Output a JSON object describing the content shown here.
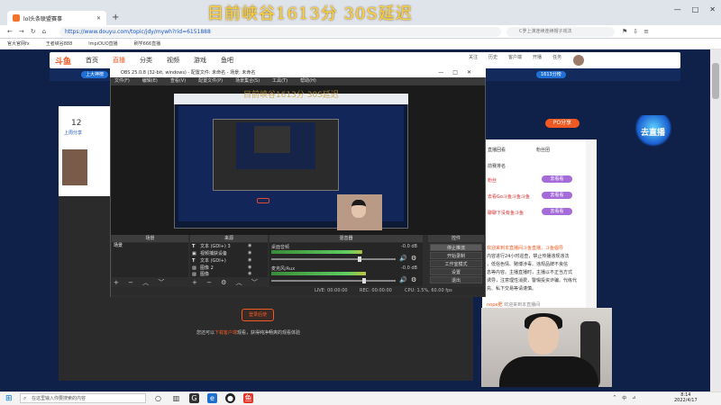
{
  "browser": {
    "tab_title": "lol头条联盟赛事",
    "new_tab": "+",
    "overlay_text": "目前峡谷1613分 30S延迟",
    "url": "https://www.douyu.com/topic/jdy/mywh?rid=6151888",
    "search_placeholder": "C罗上演连续连续帽子戏法",
    "window_controls": [
      "—",
      "□",
      "✕"
    ],
    "nav": [
      "←",
      "→",
      "↻",
      "⌂"
    ],
    "bookmarks": [
      "官大官网fx",
      "王者峡谷888",
      "lmpiOUO直播",
      "刷学666直播"
    ]
  },
  "site": {
    "logo": "斗鱼",
    "nav": [
      "首页",
      "直播",
      "分类",
      "视频",
      "游戏",
      "鱼吧"
    ],
    "active_nav": "直播",
    "nav_right": [
      "关注",
      "历史",
      "客户端",
      "开播",
      "任务"
    ],
    "banner_pills": [
      "上大神榜",
      "1613分榜"
    ],
    "card_number": "12",
    "card_label": "上周分享",
    "pos_badge": "PO分享",
    "mascot_label": "去直播",
    "side_label": "去直"
  },
  "right_panel": {
    "tabs": [
      "直播回看",
      "粉丝团"
    ],
    "rows": [
      {
        "text": "前赛排名",
        "btn": ""
      },
      {
        "text": "粉丝",
        "btn": "去看看"
      },
      {
        "text": "去看Go斗鱼斗鱼斗鱼",
        "btn": "去看看"
      },
      {
        "text": "聊聊下没有鱼斗鱼",
        "btn": "去看看"
      }
    ],
    "chat": [
      "欢迎来到本直播间斗鱼直播，斗鱼倡导",
      "内容进行24小时巡查，禁止传播违规违法",
      "，低俗色情、赌博涉毒、违规品牌不良信",
      "息等内容。主播直播时，主播以不正当方式",
      "诱导，注意理性消费，警惕投资诈骗。代练代",
      "充、私下交易等请谨慎。"
    ],
    "chat_user": "欢迎来到本直播间",
    "chat_user_name": "nope肥"
  },
  "obs": {
    "title": "OBS 25.0.8 (32-bit, windows) - 配置文件: 未命名 - 场景: 未命名",
    "menu": [
      "文件(F)",
      "编辑(E)",
      "查看(V)",
      "配置文件(P)",
      "场景集合(S)",
      "工具(T)",
      "帮助(H)"
    ],
    "docks": {
      "scenes": "场景",
      "sources": "来源",
      "mixer": "混音器",
      "controls": "控件"
    },
    "scene_item": "场景",
    "sources": [
      {
        "icon": "T",
        "name": "文本 (GDI+) 3"
      },
      {
        "icon": "▣",
        "name": "视频捕获设备"
      },
      {
        "icon": "T",
        "name": "文本 (GDI+)"
      },
      {
        "icon": "▨",
        "name": "图像 2"
      },
      {
        "icon": "▨",
        "name": "图像"
      }
    ],
    "mixer": [
      {
        "name": "桌面音频",
        "db": "-0.0 dB",
        "level": 0.72
      },
      {
        "name": "麦克风/Aux",
        "db": "-0.0 dB",
        "level": 0.75
      }
    ],
    "controls": [
      "停止推流",
      "开始录制",
      "工作室模式",
      "设置",
      "退出"
    ],
    "status": {
      "live": "LIVE: 00:00:00",
      "rec": "REC: 00:00:00",
      "cpu": "CPU: 1.5%, 60.00 fps"
    }
  },
  "below_obs": {
    "login_button": "登录后使",
    "tip_before": "您还可以",
    "tip_highlight": "下载客户端",
    "tip_after": "观看，获得纯净畅爽的观看体验"
  },
  "taskbar": {
    "start": "⊞",
    "search_placeholder": "在这里输入你要搜索的内容",
    "time": "8:14",
    "date": "2022/4/17",
    "tray": [
      "^",
      "中",
      "⊿"
    ]
  }
}
